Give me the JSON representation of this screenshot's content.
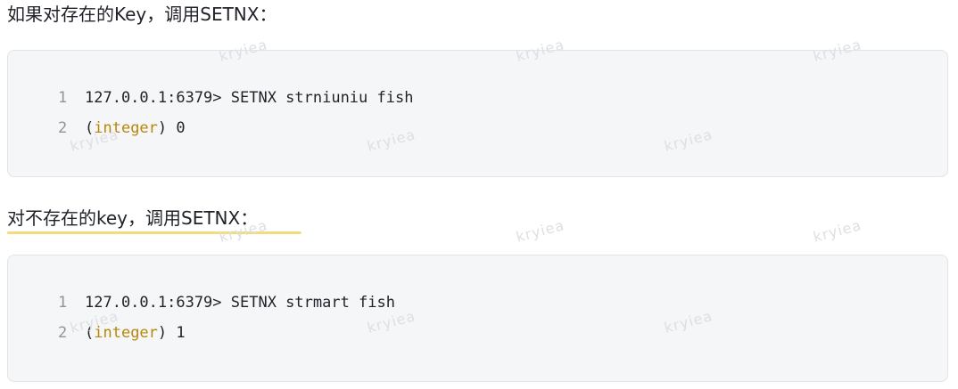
{
  "paragraphs": {
    "first": "如果对存在的Key，调用SETNX：",
    "second": "对不存在的key，调用SETNX："
  },
  "code_blocks": [
    {
      "lines": [
        {
          "num": "1",
          "text": "127.0.0.1:6379> SETNX strniuniu fish"
        },
        {
          "num": "2",
          "open": "(",
          "keyword": "integer",
          "close": ") 0"
        }
      ]
    },
    {
      "lines": [
        {
          "num": "1",
          "text": "127.0.0.1:6379> SETNX strmart fish"
        },
        {
          "num": "2",
          "open": "(",
          "keyword": "integer",
          "close": ") 1"
        }
      ]
    }
  ],
  "watermark": "kryiea",
  "colors": {
    "keyword": "#b8860b",
    "code_background": "#f5f6f7",
    "underline": "#f4dc7e"
  }
}
